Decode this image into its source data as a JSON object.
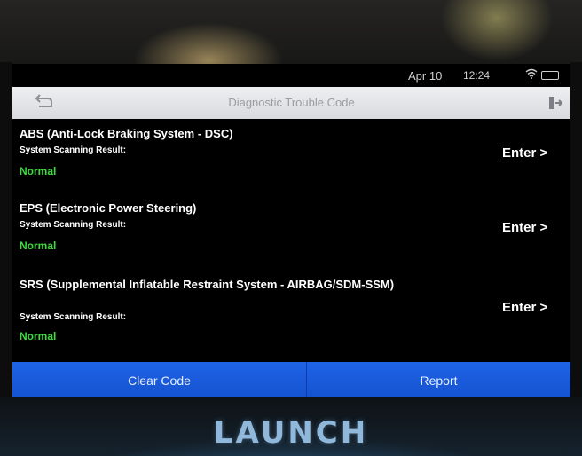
{
  "status_bar": {
    "date": "Apr 10",
    "time": "12:24"
  },
  "header": {
    "title": "Diagnostic Trouble Code"
  },
  "icons": {
    "back": "back-arrow-icon",
    "exit": "exit-icon",
    "wifi": "wifi-icon",
    "battery": "battery-icon"
  },
  "systems": [
    {
      "name": "ABS (Anti-Lock Braking System - DSC)",
      "scan_label": "System Scanning Result:",
      "result": "Normal",
      "action": "Enter >"
    },
    {
      "name": "EPS (Electronic Power Steering)",
      "scan_label": "System Scanning Result:",
      "result": "Normal",
      "action": "Enter >"
    },
    {
      "name": "SRS (Supplemental Inflatable Restraint System - AIRBAG/SDM-SSM)",
      "scan_label": "System Scanning Result:",
      "result": "Normal",
      "action": "Enter >"
    }
  ],
  "footer": {
    "clear_code": "Clear Code",
    "report": "Report"
  },
  "device": {
    "brand": "LAUNCH"
  },
  "colors": {
    "result_normal": "#3edc3e",
    "footer_blue": "#1a5cdc",
    "title_bar": "#e4e5e8"
  }
}
